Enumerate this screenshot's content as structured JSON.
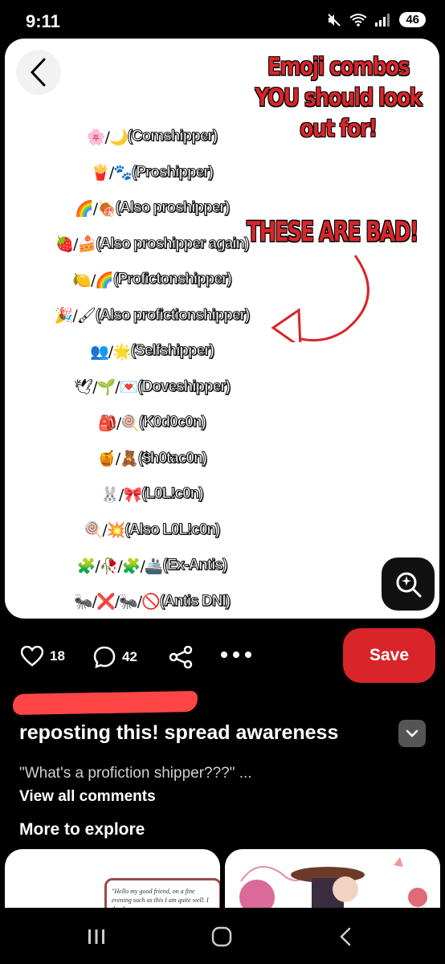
{
  "status": {
    "time": "9:11",
    "battery": "46",
    "network": "6"
  },
  "pin": {
    "headline": "Emoji combos YOU should look out for!",
    "warning": "THESE ARE BAD!",
    "combos": [
      {
        "emoji": "🌸/🌙",
        "label": "(Comshipper)"
      },
      {
        "emoji": "🍟/🐾",
        "label": "(Proshipper)"
      },
      {
        "emoji": "🌈/🍖",
        "label": "(Also proshipper)"
      },
      {
        "emoji": "🍓/🍰",
        "label": "(Also proshipper again)"
      },
      {
        "emoji": "🍋/🌈",
        "label": "(Profictonshipper)"
      },
      {
        "emoji": "🎉/🖌",
        "label": "(Also profictionshipper)"
      },
      {
        "emoji": "👥/🌟",
        "label": "(Selfshipper)"
      },
      {
        "emoji": "🕊/🌱/💌",
        "label": "(Doveshipper)"
      },
      {
        "emoji": "🎒/🍭",
        "label": "(K0d0c0n)"
      },
      {
        "emoji": "🍯/🧸",
        "label": "($h0tac0n)"
      },
      {
        "emoji": "🐰/🎀",
        "label": "(L0L!c0n)"
      },
      {
        "emoji": "🍭/💥",
        "label": "(Also L0L!c0n)"
      },
      {
        "emoji": "🧩/🥀/🧩/🚢",
        "label": "(Ex-Antis)"
      },
      {
        "emoji": "🐜/❌/🐜/🚫",
        "label": "(Antis DNI)"
      }
    ]
  },
  "actions": {
    "likes": "18",
    "comments": "42",
    "save_label": "Save"
  },
  "post": {
    "title": "reposting this! spread awareness",
    "comment_preview": "\"What's a profiction shipper???\" ...",
    "view_all": "View all comments"
  },
  "explore": {
    "heading": "More to explore",
    "thumb_quote": "\"Hello my good friend, on a fine evening such as this I am quite well. I thank you"
  },
  "colors": {
    "accent": "#d9252a",
    "warning_red": "#d8262a"
  }
}
